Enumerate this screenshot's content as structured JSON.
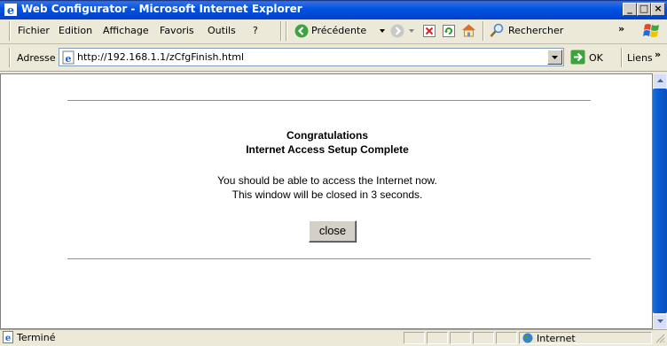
{
  "window": {
    "title": "Web Configurator - Microsoft Internet Explorer"
  },
  "menu": {
    "items": [
      "Fichier",
      "Edition",
      "Affichage",
      "Favoris",
      "Outils",
      "?"
    ]
  },
  "toolbar": {
    "back_label": "Précédente",
    "search_label": "Rechercher",
    "chevron": "»"
  },
  "address": {
    "label": "Adresse",
    "url": "http://192.168.1.1/zCfgFinish.html",
    "go_label": "OK",
    "links_label": "Liens"
  },
  "page": {
    "heading1": "Congratulations",
    "heading2": "Internet Access Setup Complete",
    "message1": "You should be able to access the Internet now.",
    "message2": "This window will be closed in 3 seconds.",
    "close_label": "close"
  },
  "status": {
    "text": "Terminé",
    "zone": "Internet"
  }
}
